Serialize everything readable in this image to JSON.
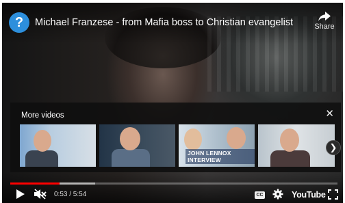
{
  "video": {
    "title": "Michael Franzese - from Mafia boss to Christian evangelist",
    "channel_avatar_glyph": "?",
    "share_label": "Share"
  },
  "more_videos": {
    "title": "More videos",
    "close_glyph": "✕",
    "next_glyph": "❯",
    "thumbnails": [
      {
        "caption": ""
      },
      {
        "caption": ""
      },
      {
        "caption": "JOHN LENNOX INTERVIEW"
      },
      {
        "caption": ""
      }
    ]
  },
  "controls": {
    "time": "0:53 / 5:54",
    "played_fraction": 0.15,
    "buffered_fraction": 0.26,
    "cc_label": "CC",
    "brand_label": "YouTube"
  },
  "colors": {
    "progress_played": "#ff0000",
    "channel_avatar": "#2d8fdc"
  },
  "icons": [
    "help-avatar-icon",
    "share-arrow-icon",
    "close-icon",
    "chevron-right-icon",
    "play-icon",
    "mute-icon",
    "captions-icon",
    "gear-icon",
    "fullscreen-icon"
  ]
}
